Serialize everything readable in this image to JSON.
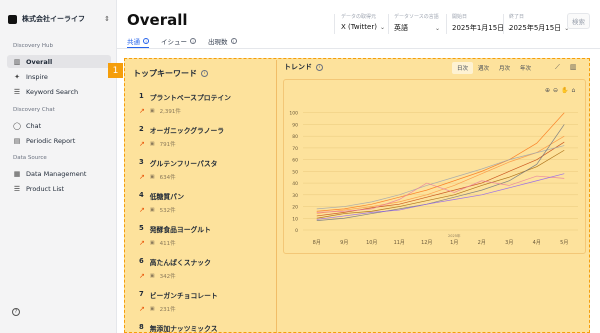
{
  "company": {
    "name": "株式会社イーライフ"
  },
  "sidebar": {
    "sections": [
      {
        "label": "Discovery Hub"
      },
      {
        "label": "Discovery Chat"
      },
      {
        "label": "Data Source"
      }
    ],
    "items": [
      {
        "label": "Overall",
        "icon": "bar-chart-icon"
      },
      {
        "label": "Inspire",
        "icon": "sparkle-icon"
      },
      {
        "label": "Keyword Search",
        "icon": "list-icon"
      },
      {
        "label": "Chat",
        "icon": "chat-icon"
      },
      {
        "label": "Periodic Report",
        "icon": "document-icon"
      },
      {
        "label": "Data Management",
        "icon": "database-icon"
      },
      {
        "label": "Product List",
        "icon": "list-icon"
      }
    ]
  },
  "header": {
    "title": "Overall",
    "filters": [
      {
        "label": "データの取得元",
        "value": "X (Twitter)"
      },
      {
        "label": "データソースの言語",
        "value": "英語"
      },
      {
        "label": "開始日",
        "value": "2025年1月15日"
      },
      {
        "label": "終了日",
        "value": "2025年5月15日"
      }
    ],
    "search_label": "検索"
  },
  "tabs": [
    {
      "label": "共通"
    },
    {
      "label": "イシュー"
    },
    {
      "label": "出現数"
    }
  ],
  "badge": "1",
  "keywords": {
    "title": "トップキーワード",
    "items": [
      {
        "rank": "1",
        "name": "プラントベースプロテイン",
        "count": "2,391件"
      },
      {
        "rank": "2",
        "name": "オーガニックグラノーラ",
        "count": "791件"
      },
      {
        "rank": "3",
        "name": "グルテンフリーパスタ",
        "count": "634件"
      },
      {
        "rank": "4",
        "name": "低糖質パン",
        "count": "532件"
      },
      {
        "rank": "5",
        "name": "発酵食品ヨーグルト",
        "count": "411件"
      },
      {
        "rank": "6",
        "name": "高たんぱくスナック",
        "count": "342件"
      },
      {
        "rank": "7",
        "name": "ビーガンチョコレート",
        "count": "231件"
      },
      {
        "rank": "8",
        "name": "無添加ナッツミックス",
        "count": ""
      }
    ]
  },
  "trend": {
    "title": "トレンド",
    "periods": [
      "日次",
      "週次",
      "月次",
      "年次"
    ],
    "active_period": "日次",
    "year_label": "2025年"
  },
  "chart_data": {
    "type": "line",
    "x": [
      "8月",
      "9月",
      "10月",
      "11月",
      "12月",
      "1月",
      "2月",
      "3月",
      "4月",
      "5月"
    ],
    "ylim": [
      0,
      110
    ],
    "yticks": [
      0,
      10,
      20,
      30,
      40,
      50,
      60,
      70,
      80,
      90,
      100
    ],
    "colors": [
      "#f97316",
      "#fb923c",
      "#c2410c",
      "#a16207",
      "#9ca3af",
      "#6b7280",
      "#e879a0",
      "#8b5cf6"
    ],
    "series": [
      {
        "values": [
          16,
          18,
          22,
          28,
          34,
          42,
          50,
          60,
          74,
          100
        ]
      },
      {
        "values": [
          14,
          17,
          20,
          24,
          30,
          38,
          48,
          58,
          66,
          80
        ]
      },
      {
        "values": [
          12,
          15,
          19,
          22,
          28,
          34,
          40,
          50,
          60,
          75
        ]
      },
      {
        "values": [
          10,
          14,
          16,
          20,
          25,
          30,
          38,
          45,
          54,
          68
        ]
      },
      {
        "values": [
          18,
          20,
          24,
          30,
          38,
          45,
          52,
          60,
          66,
          72
        ]
      },
      {
        "values": [
          8,
          10,
          14,
          18,
          22,
          28,
          34,
          42,
          56,
          90
        ]
      },
      {
        "values": [
          15,
          16,
          18,
          26,
          40,
          32,
          42,
          38,
          46,
          44
        ]
      },
      {
        "values": [
          9,
          12,
          15,
          17,
          22,
          26,
          30,
          36,
          42,
          48
        ]
      }
    ]
  }
}
